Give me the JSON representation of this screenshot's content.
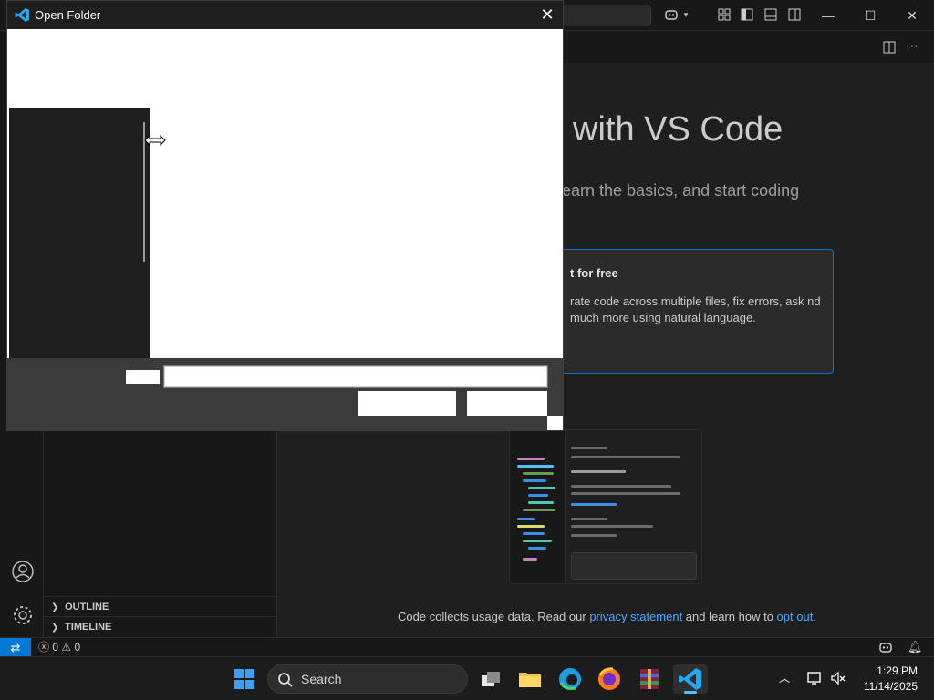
{
  "dialog": {
    "title": "Open Folder",
    "close_glyph": "✕"
  },
  "welcome": {
    "title": "with VS Code",
    "subtitle": "earn the basics, and start coding",
    "card_title": "t for free",
    "card_body": "rate code across multiple files, fix errors, ask nd much more using natural language.",
    "footer_pre": "Code collects usage data. Read our ",
    "footer_link1": "privacy statement",
    "footer_mid": " and learn how to ",
    "footer_link2": "opt out",
    "footer_post": "."
  },
  "sidebar": {
    "outline": "OUTLINE",
    "timeline": "TIMELINE"
  },
  "statusbar": {
    "errors": "0",
    "warnings": "0"
  },
  "taskbar": {
    "search_label": "Search",
    "time": "1:29 PM",
    "date": "11/14/2025"
  },
  "colors": {
    "accent": "#0078d4",
    "link": "#4daafc",
    "editor_bg": "#1f1f1f"
  }
}
